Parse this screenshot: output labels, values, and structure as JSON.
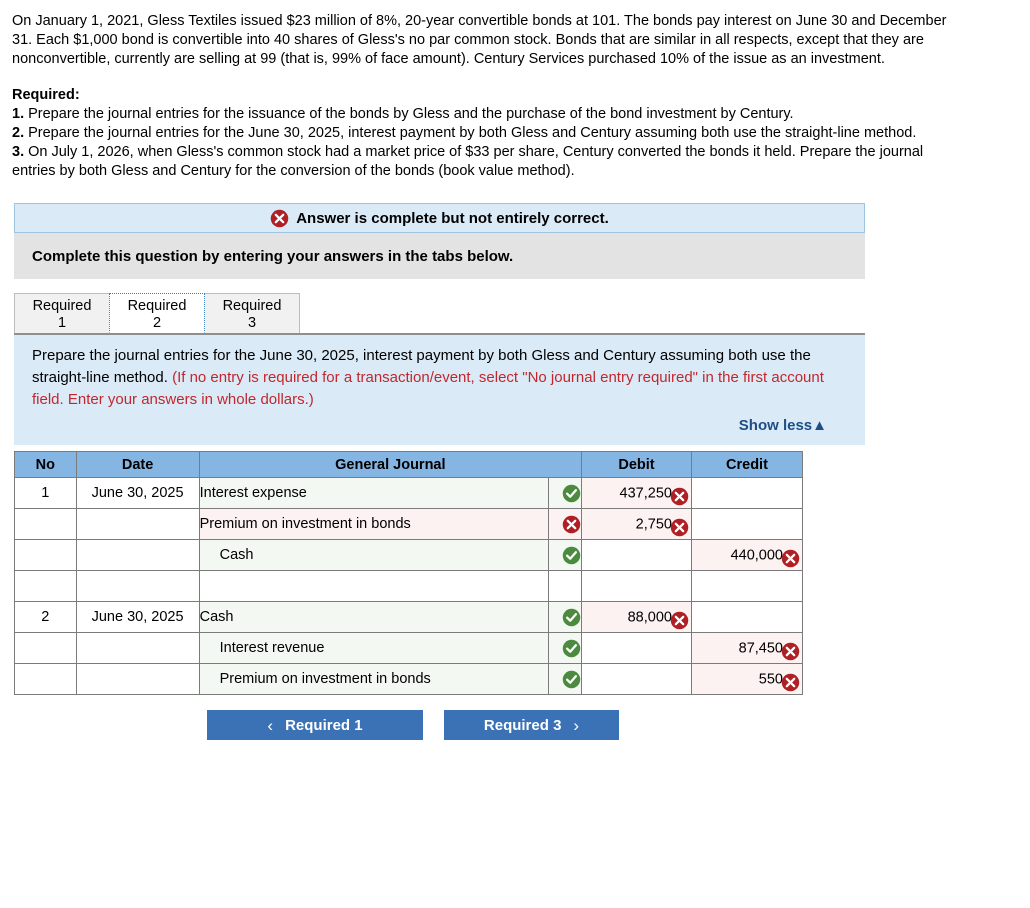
{
  "stem": {
    "paragraph": "On January 1, 2021, Gless Textiles issued $23 million of 8%, 20-year convertible bonds at 101. The bonds pay interest on June 30 and December 31. Each $1,000 bond is convertible into 40 shares of Gless's no par common stock. Bonds that are similar in all respects, except that they are nonconvertible, currently are selling at 99 (that is, 99% of face amount). Century Services purchased 10% of the issue as an investment."
  },
  "required": {
    "heading": "Required:",
    "items": [
      {
        "num": "1.",
        "text": " Prepare the journal entries for the issuance of the bonds by Gless and the purchase of the bond investment by Century."
      },
      {
        "num": "2.",
        "text": " Prepare the journal entries for the June 30, 2025, interest payment by both Gless and Century assuming both use the straight-line method."
      },
      {
        "num": "3.",
        "text": " On July 1, 2026, when Gless's common stock had a market price of $33 per share, Century converted the bonds it held. Prepare the journal entries by both Gless and Century for the conversion of the bonds (book value method)."
      }
    ]
  },
  "banner": {
    "icon": "error-circle-icon",
    "text": "Answer is complete but not entirely correct.",
    "bg_color": "#dbeaf7",
    "icon_color": "#b01f24"
  },
  "sub_banner": {
    "text": "Complete this question by entering your answers in the tabs below.",
    "bg_color": "#e3e3e3"
  },
  "tabs": [
    {
      "line1": "Required",
      "line2": "1",
      "active": false
    },
    {
      "line1": "Required",
      "line2": "2",
      "active": true
    },
    {
      "line1": "Required",
      "line2": "3",
      "active": false
    }
  ],
  "instruction": {
    "black_text": "Prepare the journal entries for the June 30, 2025, interest payment by both Gless and Century assuming both use the straight-line method. ",
    "red_text": "(If no entry is required for a transaction/event, select \"No journal entry required\" in the first account field. Enter your answers in whole dollars.)",
    "show_less": "Show less",
    "show_less_caret": "▲",
    "link_color": "#1f4e87",
    "red_color": "#c0282d"
  },
  "journal": {
    "header_bg": "#85b5e2",
    "columns": [
      "No",
      "Date",
      "General Journal",
      "Debit",
      "Credit"
    ],
    "rows": [
      {
        "no": "1",
        "date": "June 30, 2025",
        "account": "Interest expense",
        "indent": false,
        "mark": "check",
        "debit": "437,250",
        "debit_mark": "x",
        "credit": "",
        "credit_mark": ""
      },
      {
        "no": "",
        "date": "",
        "account": "Premium on investment in bonds",
        "indent": false,
        "mark": "x",
        "debit": "2,750",
        "debit_mark": "x",
        "credit": "",
        "credit_mark": ""
      },
      {
        "no": "",
        "date": "",
        "account": "Cash",
        "indent": true,
        "mark": "check",
        "debit": "",
        "debit_mark": "",
        "credit": "440,000",
        "credit_mark": "x"
      },
      {
        "no": "",
        "date": "",
        "account": "",
        "indent": false,
        "mark": "",
        "debit": "",
        "debit_mark": "",
        "credit": "",
        "credit_mark": ""
      },
      {
        "no": "2",
        "date": "June 30, 2025",
        "account": "Cash",
        "indent": false,
        "mark": "check",
        "debit": "88,000",
        "debit_mark": "x",
        "credit": "",
        "credit_mark": ""
      },
      {
        "no": "",
        "date": "",
        "account": "Interest revenue",
        "indent": true,
        "mark": "check",
        "debit": "",
        "debit_mark": "",
        "credit": "87,450",
        "credit_mark": "x"
      },
      {
        "no": "",
        "date": "",
        "account": "Premium on investment in bonds",
        "indent": true,
        "mark": "check",
        "debit": "",
        "debit_mark": "",
        "credit": "550",
        "credit_mark": "x"
      }
    ]
  },
  "nav": {
    "prev_label": "Required 1",
    "prev_chevron": "‹",
    "next_label": "Required 3",
    "next_chevron": "›",
    "button_color": "#3a72b5"
  }
}
